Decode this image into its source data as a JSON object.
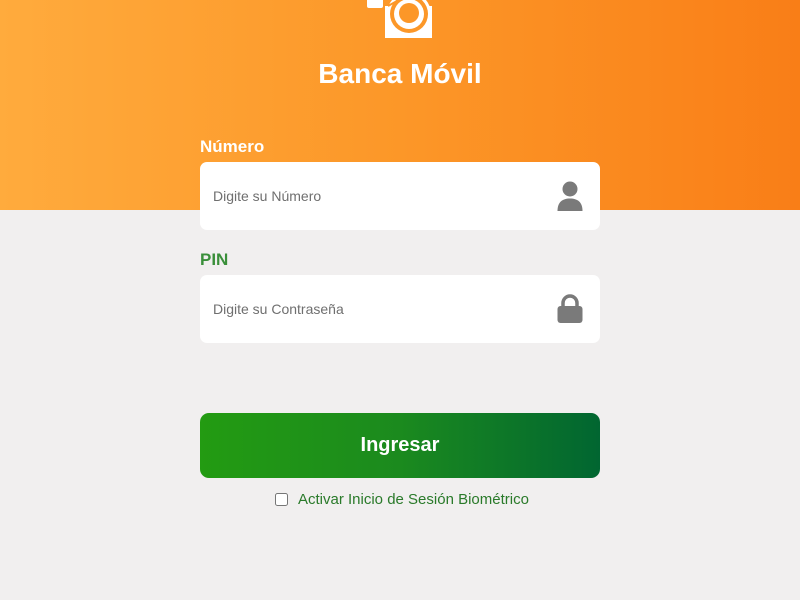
{
  "header": {
    "title": "Banca Móvil",
    "gradient_colors": [
      "#ffab3d",
      "#f97e17"
    ]
  },
  "form": {
    "numero": {
      "label": "Número",
      "placeholder": "Digite su Número",
      "value": "",
      "icon": "user-icon"
    },
    "pin": {
      "label": "PIN",
      "placeholder": "Digite su Contraseña",
      "value": "",
      "icon": "lock-icon"
    },
    "submit_label": "Ingresar",
    "biometric": {
      "label": "Activar Inicio de Sesión Biométrico",
      "checked": false
    }
  },
  "colors": {
    "accent_orange": "#fc9728",
    "accent_green": "#239b12",
    "background": "#f1efef"
  }
}
